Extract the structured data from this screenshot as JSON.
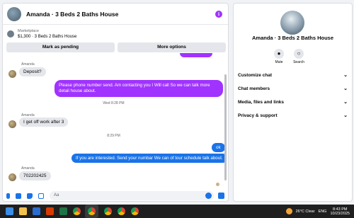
{
  "chat": {
    "title": "Amanda · 3 Beds 2 Baths House",
    "marketplace_label": "Marketplace",
    "marketplace_item": "$1,300 · 3 Beds 2 Baths House",
    "actions": [
      "Mark as pending",
      "More options"
    ],
    "messages": [
      {
        "sender": "Amanda",
        "text": "Deposit?"
      },
      {
        "text": "Please phone number send. Am contacting you I Will call So we can talk more detail house about."
      },
      {
        "timestamp": "Wed 8:28 PM"
      },
      {
        "sender": "Amanda",
        "text": "I get off work after 3"
      },
      {
        "timestamp": "8:29 PM"
      },
      {
        "text": "ok"
      },
      {
        "text": "If you are interested. Send your numbar We can of tour  schedule talk about."
      },
      {
        "sender": "Amanda",
        "text": "702202425"
      }
    ],
    "composer_placeholder": "Aa"
  },
  "side": {
    "title": "Amanda · 3 Beds 2 Baths House",
    "buttons": [
      "Mute",
      "Search"
    ],
    "sections": [
      "Customize chat",
      "Chat members",
      "Media, files and links",
      "Privacy & support"
    ]
  },
  "taskbar": {
    "weather": "26°C  Clear",
    "lang": "ENG",
    "time": "8:43 PM",
    "date": "10/23/2025"
  }
}
